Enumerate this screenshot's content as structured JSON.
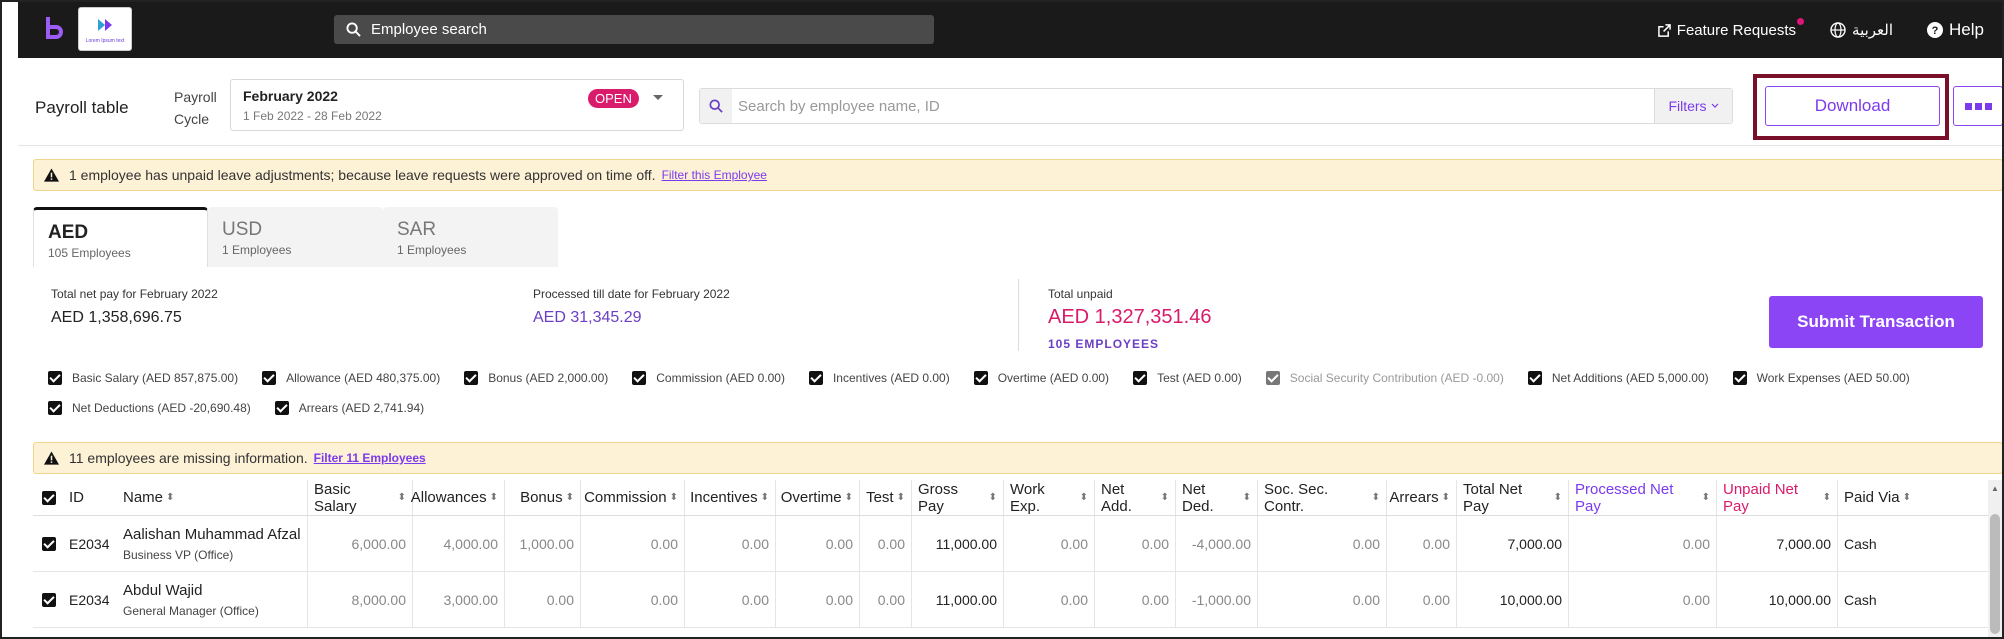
{
  "topbar": {
    "logo_tagline": "Lorem Ipsum text",
    "search_label": "Employee search",
    "feature_requests": "Feature Requests",
    "language": "العربية",
    "help": "Help"
  },
  "header": {
    "title": "Payroll table",
    "cycle_label": "Payroll Cycle",
    "cycle_month": "February 2022",
    "cycle_range": "1 Feb 2022 - 28 Feb 2022",
    "cycle_status": "OPEN",
    "search_placeholder": "Search by employee name, ID",
    "filters_label": "Filters",
    "download_label": "Download"
  },
  "alerts": {
    "leave": {
      "text": "1 employee has unpaid leave adjustments; because leave requests were approved on time off.",
      "link": "Filter this Employee"
    },
    "missing": {
      "text": "11 employees are missing information.",
      "link": "Filter 11 Employees"
    }
  },
  "tabs": [
    {
      "code": "AED",
      "count": "105 Employees",
      "active": true
    },
    {
      "code": "USD",
      "count": "1 Employees",
      "active": false
    },
    {
      "code": "SAR",
      "count": "1 Employees",
      "active": false
    }
  ],
  "summary": {
    "net_pay_label": "Total net pay for February 2022",
    "net_pay_value": "AED 1,358,696.75",
    "processed_label": "Processed till date for February 2022",
    "processed_value": "AED 31,345.29",
    "unpaid_label": "Total unpaid",
    "unpaid_value": "AED 1,327,351.46",
    "unpaid_employees": "105 EMPLOYEES",
    "submit_label": "Submit Transaction"
  },
  "components": [
    {
      "label": "Basic Salary (AED 857,875.00)",
      "checked": true
    },
    {
      "label": "Allowance (AED 480,375.00)",
      "checked": true
    },
    {
      "label": "Bonus (AED 2,000.00)",
      "checked": true
    },
    {
      "label": "Commission (AED 0.00)",
      "checked": true
    },
    {
      "label": "Incentives (AED 0.00)",
      "checked": true
    },
    {
      "label": "Overtime (AED 0.00)",
      "checked": true
    },
    {
      "label": "Test (AED 0.00)",
      "checked": true
    },
    {
      "label": "Social Security Contribution (AED -0.00)",
      "checked": true,
      "disabled": true
    },
    {
      "label": "Net Additions (AED 5,000.00)",
      "checked": true
    },
    {
      "label": "Work Expenses (AED 50.00)",
      "checked": true
    },
    {
      "label": "Net Deductions (AED -20,690.48)",
      "checked": true
    },
    {
      "label": "Arrears (AED 2,741.94)",
      "checked": true
    }
  ],
  "table": {
    "columns": [
      "ID",
      "Name",
      "Basic Salary",
      "Allowances",
      "Bonus",
      "Commission",
      "Incentives",
      "Overtime",
      "Test",
      "Gross Pay",
      "Work Exp.",
      "Net Add.",
      "Net Ded.",
      "Soc. Sec. Contr.",
      "Arrears",
      "Total Net Pay",
      "Processed Net Pay",
      "Unpaid Net Pay",
      "Paid Via"
    ],
    "rows": [
      {
        "id": "E2034",
        "name": "Aalishan Muhammad Afzal",
        "title": "Business VP (Office)",
        "basic": "6,000.00",
        "allow": "4,000.00",
        "bonus": "1,000.00",
        "comm": "0.00",
        "inc": "0.00",
        "ot": "0.00",
        "test": "0.00",
        "gross": "11,000.00",
        "wexp": "0.00",
        "nadd": "0.00",
        "nded": "-4,000.00",
        "ssc": "0.00",
        "arr": "0.00",
        "total": "7,000.00",
        "proc": "0.00",
        "unpaid": "7,000.00",
        "via": "Cash"
      },
      {
        "id": "E2034",
        "name": "Abdul Wajid",
        "title": "General Manager (Office)",
        "basic": "8,000.00",
        "allow": "3,000.00",
        "bonus": "0.00",
        "comm": "0.00",
        "inc": "0.00",
        "ot": "0.00",
        "test": "0.00",
        "gross": "11,000.00",
        "wexp": "0.00",
        "nadd": "0.00",
        "nded": "-1,000.00",
        "ssc": "0.00",
        "arr": "0.00",
        "total": "10,000.00",
        "proc": "0.00",
        "unpaid": "10,000.00",
        "via": "Cash"
      }
    ]
  },
  "colors": {
    "accent": "#8b45f5",
    "pink": "#d81b6a",
    "highlight": "#7a0f2a"
  }
}
